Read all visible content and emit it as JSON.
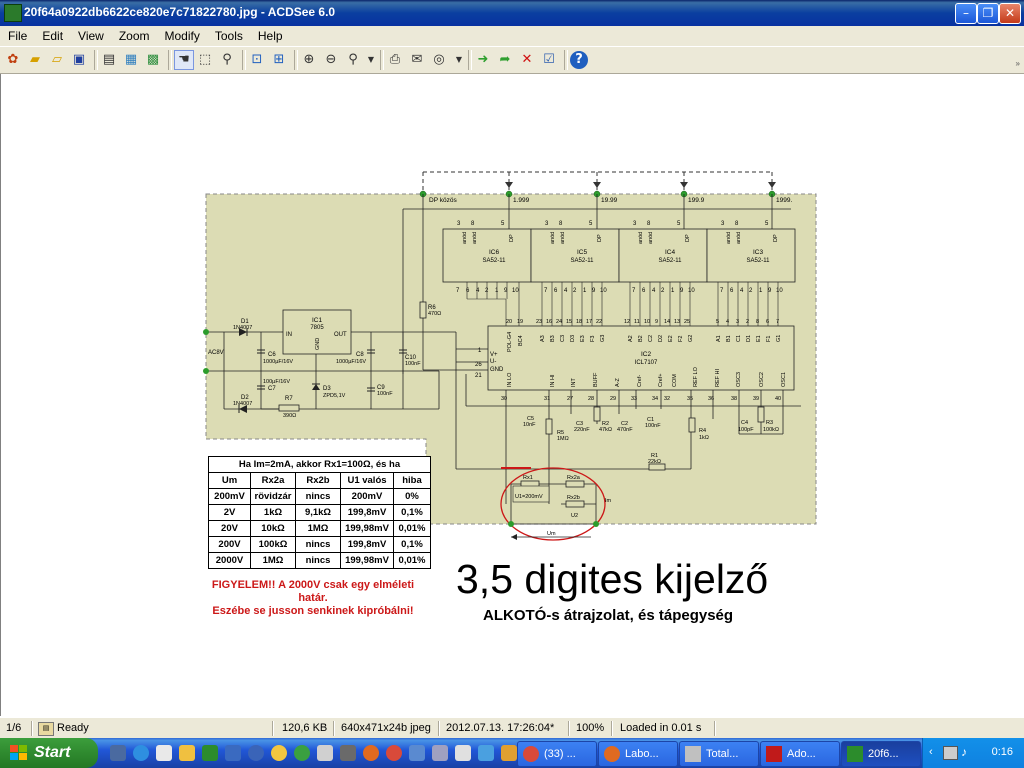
{
  "window": {
    "title": "20f64a0922db6622ce820e7c71822780.jpg - ACDSee 6.0",
    "minimize": "–",
    "maximize": "❐",
    "close": "✕"
  },
  "menu": [
    "File",
    "Edit",
    "View",
    "Zoom",
    "Modify",
    "Tools",
    "Help"
  ],
  "schematic": {
    "dp_kozos": "DP közös",
    "dp_values": [
      "1.999",
      "19.99",
      "199.9",
      "1999."
    ],
    "displays": [
      {
        "name": "IC6",
        "part": "SA52-11"
      },
      {
        "name": "IC5",
        "part": "SA52-11"
      },
      {
        "name": "IC4",
        "part": "SA52-11"
      },
      {
        "name": "IC3",
        "part": "SA52-11"
      }
    ],
    "pin_top": [
      "3",
      "8",
      "5"
    ],
    "seg_anod": "anód",
    "seg_dp": "DP",
    "pin_bottom": [
      "7",
      "6",
      "4",
      "2",
      "1",
      "9",
      "10"
    ],
    "ic2": {
      "name": "IC2",
      "part": "ICL7107"
    },
    "ic2_top_pins": [
      "POL-G4",
      "BC4",
      "A3",
      "B3",
      "C3",
      "D3",
      "E3",
      "F3",
      "G3",
      "A2",
      "B2",
      "C2",
      "D2",
      "E2",
      "F2",
      "G2",
      "A1",
      "B1",
      "C1",
      "D1",
      "E1",
      "F1",
      "G1"
    ],
    "ic2_top_nums": [
      "20",
      "19",
      "23",
      "16",
      "24",
      "15",
      "18",
      "17",
      "22",
      "12",
      "11",
      "10",
      "9",
      "14",
      "13",
      "25",
      "5",
      "4",
      "3",
      "2",
      "8",
      "6",
      "7"
    ],
    "ic2_left": [
      {
        "num": "1",
        "label": "V+"
      },
      {
        "num": "26",
        "label": "U-"
      },
      {
        "num": "21",
        "label": "GND"
      }
    ],
    "ic2_bottom": [
      {
        "num": "30",
        "label": "IN LO"
      },
      {
        "num": "31",
        "label": "IN HI"
      },
      {
        "num": "27",
        "label": "INT"
      },
      {
        "num": "28",
        "label": "BUFF"
      },
      {
        "num": "29",
        "label": "A-Z"
      },
      {
        "num": "33",
        "label": "Cref-"
      },
      {
        "num": "34",
        "label": "Cref+"
      },
      {
        "num": "32",
        "label": "COM"
      },
      {
        "num": "35",
        "label": "REF LO"
      },
      {
        "num": "36",
        "label": "REF HI"
      },
      {
        "num": "38",
        "label": "OSC3"
      },
      {
        "num": "39",
        "label": "OSC2"
      },
      {
        "num": "40",
        "label": "OSC1"
      }
    ],
    "power": {
      "ac": "AC8V",
      "d1": "D1",
      "d1v": "1N4007",
      "d2": "D2",
      "d2v": "1N4007",
      "ic1": "IC1",
      "ic1v": "7805",
      "in": "IN",
      "out": "OUT",
      "gnd": "GND",
      "c6": "C6",
      "c6v": "1000µF/16V",
      "c7": "C7",
      "c7v": "100µF/16V",
      "c8": "C8",
      "c8v": "1000µF/16V",
      "c10": "C10",
      "c10v": "100nF",
      "c9": "C9",
      "c9v": "100nF",
      "d3": "D3",
      "d3v": "ZPD5,1V",
      "r7": "R7",
      "r7v": "390Ω",
      "r6": "R6",
      "r6v": "470Ω"
    },
    "parts": {
      "c5": "C5",
      "c5v": "10nF",
      "r5": "R5",
      "r5v": "1MΩ",
      "c3": "C3",
      "c3v": "220nF",
      "r2": "R2",
      "r2v": "47kΩ",
      "c2": "C2",
      "c2v": "470nF",
      "c1": "C1",
      "c1v": "100nF",
      "r4": "R4",
      "r4v": "1kΩ",
      "c4": "C4",
      "c4v": "100pF",
      "r3": "R3",
      "r3v": "100kΩ",
      "r1": "R1",
      "r1v": "22kΩ",
      "rx1": "Rx1",
      "rx2a": "Rx2a",
      "rx2b": "Rx2b",
      "u1": "U1=200mV",
      "u2": "U2",
      "im": "Im",
      "um": "Um"
    }
  },
  "table": {
    "caption": "Ha Im=2mA, akkor Rx1=100Ω, és ha",
    "headers": [
      "Um",
      "Rx2a",
      "Rx2b",
      "U1 valós",
      "hiba"
    ],
    "rows": [
      [
        "200mV",
        "rövidzár",
        "nincs",
        "200mV",
        "0%"
      ],
      [
        "2V",
        "1kΩ",
        "9,1kΩ",
        "199,8mV",
        "0,1%"
      ],
      [
        "20V",
        "10kΩ",
        "1MΩ",
        "199,98mV",
        "0,01%"
      ],
      [
        "200V",
        "100kΩ",
        "nincs",
        "199,8mV",
        "0,1%"
      ],
      [
        "2000V",
        "1MΩ",
        "nincs",
        "199,98mV",
        "0,01%"
      ]
    ]
  },
  "warning": [
    "FIGYELEM!! A 2000V csak egy elméleti határ.",
    "Eszébe se jusson senkinek kipróbálni!"
  ],
  "heading": "3,5 digites kijelző",
  "subheading": "ALKOTÓ-s átrajzolat, és tápegység",
  "status": {
    "page": "1/6",
    "state": "Ready",
    "size": "120,6 KB",
    "dims": "640x471x24b jpeg",
    "date": "2012.07.13. 17:26:04*",
    "zoom": "100%",
    "load": "Loaded in 0.01 s"
  },
  "taskbar": {
    "start": "Start",
    "tasks": [
      "(33) ...",
      "Labo...",
      "Total...",
      "Ado...",
      "20f6..."
    ],
    "clock": "0:16"
  },
  "colors": {
    "board": "#dcdcb4",
    "accent_red": "#cc1818",
    "titlebar": "#0a3fa0"
  }
}
